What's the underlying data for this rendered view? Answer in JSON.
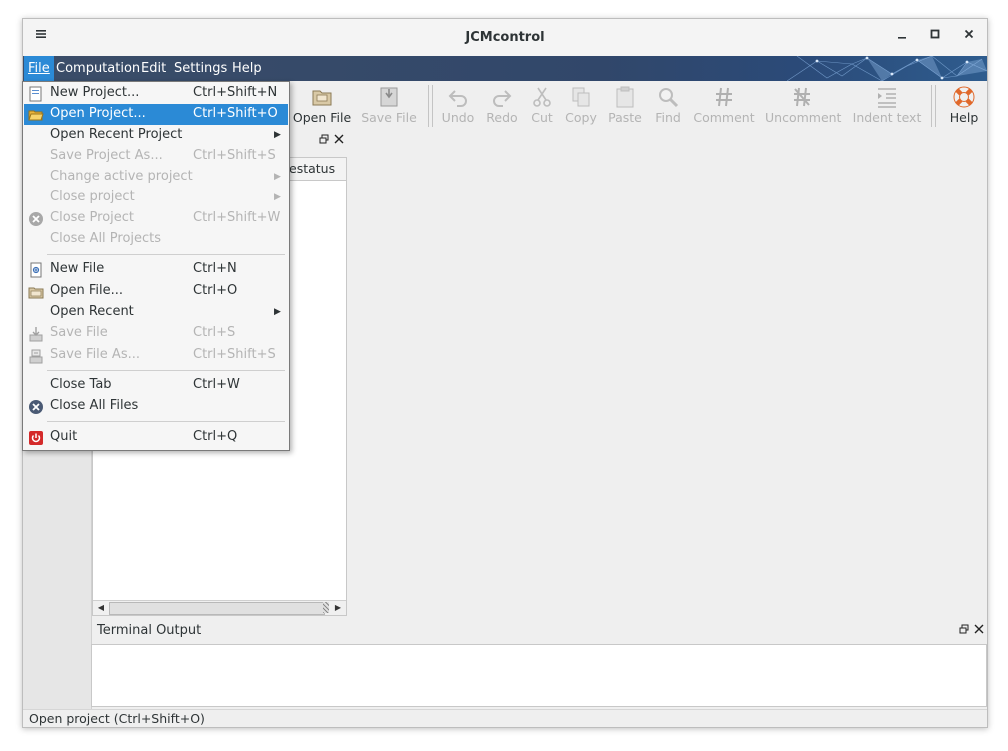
{
  "window": {
    "title": "JCMcontrol"
  },
  "titlebar": {
    "menu_icon": "hamburger-icon",
    "min_icon": "minimize-icon",
    "max_icon": "maximize-icon",
    "close_icon": "close-icon"
  },
  "menubar": {
    "items": [
      {
        "label": "File",
        "underline": "F"
      },
      {
        "label": "Computation"
      },
      {
        "label": "Edit"
      },
      {
        "label": "Settings"
      },
      {
        "label": "Help"
      }
    ]
  },
  "toolbar": {
    "open_file": "Open File",
    "save_file": "Save File",
    "undo": "Undo",
    "redo": "Redo",
    "cut": "Cut",
    "copy": "Copy",
    "paste": "Paste",
    "find": "Find",
    "comment": "Comment",
    "uncomment": "Uncomment",
    "indent": "Indent text",
    "help": "Help"
  },
  "project_panel": {
    "column_header": "estatus"
  },
  "terminal": {
    "title": "Terminal Output"
  },
  "statusbar": {
    "text": "Open project (Ctrl+Shift+O)"
  },
  "file_menu": {
    "items": [
      {
        "label": "New Project...",
        "shortcut": "Ctrl+Shift+N"
      },
      {
        "label": "Open Project...",
        "shortcut": "Ctrl+Shift+O"
      },
      {
        "label": "Open Recent Project",
        "shortcut": ""
      },
      {
        "label": "Save Project As...",
        "shortcut": "Ctrl+Shift+S"
      },
      {
        "label": "Change active project",
        "shortcut": ""
      },
      {
        "label": "Close project",
        "shortcut": ""
      },
      {
        "label": "Close Project",
        "shortcut": "Ctrl+Shift+W"
      },
      {
        "label": "Close All Projects",
        "shortcut": ""
      },
      {
        "label": "New File",
        "shortcut": "Ctrl+N"
      },
      {
        "label": "Open File...",
        "shortcut": "Ctrl+O"
      },
      {
        "label": "Open Recent",
        "shortcut": ""
      },
      {
        "label": "Save File",
        "shortcut": "Ctrl+S"
      },
      {
        "label": "Save File As...",
        "shortcut": "Ctrl+Shift+S"
      },
      {
        "label": "Close Tab",
        "shortcut": "Ctrl+W"
      },
      {
        "label": "Close All Files",
        "shortcut": ""
      },
      {
        "label": "Quit",
        "shortcut": "Ctrl+Q"
      }
    ]
  },
  "colors": {
    "accent": "#2b8ad6",
    "menubar": "#33496b",
    "disabled": "#b4b4b4"
  }
}
